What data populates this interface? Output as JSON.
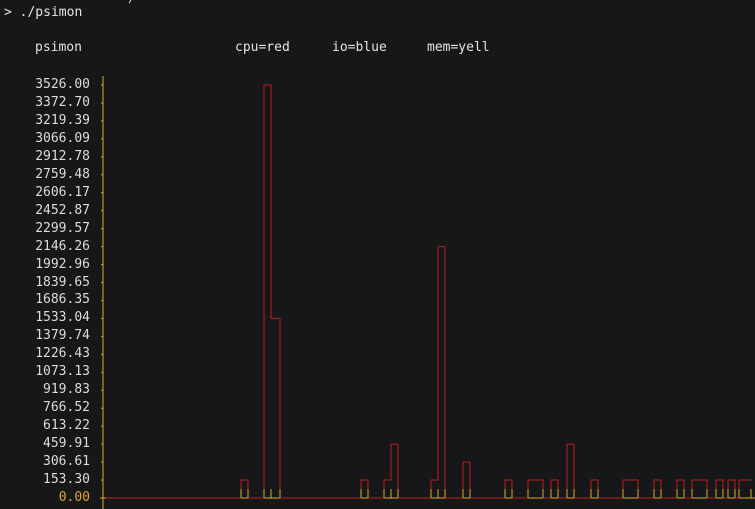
{
  "terminal": {
    "prompt_symbol": ">",
    "command": "./psimon",
    "previous_line_fragment": "▸ ~         ▸ ⌥ ╱"
  },
  "header": {
    "app_name": "psimon",
    "legend": [
      {
        "label": "cpu=red",
        "color": "#c01c1c"
      },
      {
        "label": "io=blue",
        "color": "#2a5bd7"
      },
      {
        "label": "mem=yell",
        "color": "#d9a72b"
      }
    ]
  },
  "colors": {
    "background": "#161719",
    "axis": "#d9a72b",
    "cpu": "#c01c1c"
  },
  "chart_data": {
    "type": "line",
    "title": "",
    "xlabel": "",
    "ylabel": "",
    "ylim": [
      0,
      3526.0
    ],
    "y_ticks": [
      "3526.00",
      "3372.70",
      "3219.39",
      "3066.09",
      "2912.78",
      "2759.48",
      "2606.17",
      "2452.87",
      "2299.57",
      "2146.26",
      "1992.96",
      "1839.65",
      "1686.35",
      "1533.04",
      "1379.74",
      "1226.43",
      "1073.13",
      "919.83",
      "766.52",
      "613.22",
      "459.91",
      "306.61",
      "153.30",
      "0.00"
    ],
    "series": [
      {
        "name": "cpu",
        "color": "#c01c1c",
        "points": [
          [
            0,
            0
          ],
          [
            135,
            0
          ],
          [
            135,
            153.3
          ],
          [
            142,
            153.3
          ],
          [
            142,
            0
          ],
          [
            158,
            0
          ],
          [
            158,
            3526
          ],
          [
            165,
            3526
          ],
          [
            165,
            1533.04
          ],
          [
            174,
            1533.04
          ],
          [
            174,
            0
          ],
          [
            255,
            0
          ],
          [
            255,
            153.3
          ],
          [
            262,
            153.3
          ],
          [
            262,
            0
          ],
          [
            278,
            0
          ],
          [
            278,
            153.3
          ],
          [
            285,
            153.3
          ],
          [
            285,
            459.91
          ],
          [
            292,
            459.91
          ],
          [
            292,
            0
          ],
          [
            325,
            0
          ],
          [
            325,
            153.3
          ],
          [
            332,
            153.3
          ],
          [
            332,
            2146.26
          ],
          [
            339,
            2146.26
          ],
          [
            339,
            0
          ],
          [
            357,
            0
          ],
          [
            357,
            306.61
          ],
          [
            364,
            306.61
          ],
          [
            364,
            0
          ],
          [
            399,
            0
          ],
          [
            399,
            153.3
          ],
          [
            406,
            153.3
          ],
          [
            406,
            0
          ],
          [
            422,
            0
          ],
          [
            422,
            153.3
          ],
          [
            437,
            153.3
          ],
          [
            437,
            0
          ],
          [
            445,
            0
          ],
          [
            445,
            153.3
          ],
          [
            452,
            153.3
          ],
          [
            452,
            0
          ],
          [
            461,
            0
          ],
          [
            461,
            459.91
          ],
          [
            468,
            459.91
          ],
          [
            468,
            0
          ],
          [
            485,
            0
          ],
          [
            485,
            153.3
          ],
          [
            492,
            153.3
          ],
          [
            492,
            0
          ],
          [
            517,
            0
          ],
          [
            517,
            153.3
          ],
          [
            532,
            153.3
          ],
          [
            532,
            0
          ],
          [
            548,
            0
          ],
          [
            548,
            153.3
          ],
          [
            555,
            153.3
          ],
          [
            555,
            0
          ],
          [
            571,
            0
          ],
          [
            571,
            153.3
          ],
          [
            578,
            153.3
          ],
          [
            578,
            0
          ],
          [
            586,
            0
          ],
          [
            586,
            153.3
          ],
          [
            601,
            153.3
          ],
          [
            601,
            0
          ],
          [
            610,
            0
          ],
          [
            610,
            153.3
          ],
          [
            617,
            153.3
          ],
          [
            617,
            0
          ],
          [
            622,
            0
          ],
          [
            622,
            153.3
          ],
          [
            629,
            153.3
          ],
          [
            629,
            0
          ],
          [
            633,
            0
          ],
          [
            633,
            153.3
          ],
          [
            645,
            153.3
          ]
        ]
      }
    ],
    "grid": false
  }
}
